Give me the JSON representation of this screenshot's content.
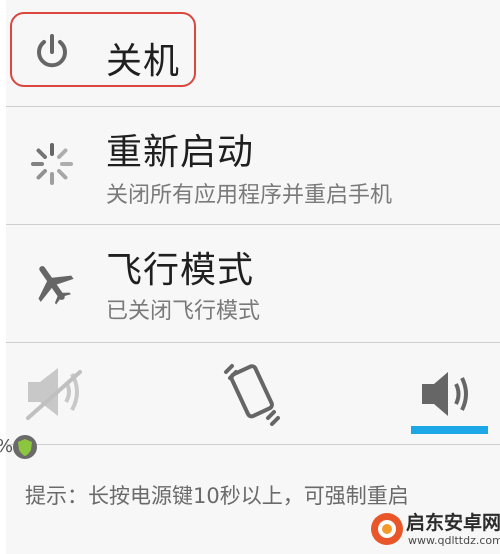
{
  "power_menu": {
    "power_off": {
      "label": "关机",
      "icon": "power-icon"
    },
    "restart": {
      "label": "重新启动",
      "subtitle": "关闭所有应用程序并重启手机",
      "icon": "loading-spinner-icon"
    },
    "airplane": {
      "label": "飞行模式",
      "subtitle": "已关闭飞行模式",
      "icon": "airplane-icon"
    }
  },
  "sound_modes": {
    "silent": {
      "icon": "muted-speaker-icon",
      "selected": false
    },
    "vibrate": {
      "icon": "vibrate-phone-icon",
      "selected": false
    },
    "sound_on": {
      "icon": "speaker-volume-icon",
      "selected": true
    }
  },
  "hint": "提示：长按电源键10秒以上，可强制重启",
  "status_fragment": {
    "percent_sign": "%"
  },
  "watermark": {
    "name": "启东安卓网",
    "url": "www.qdlttdz.com"
  },
  "colors": {
    "highlight": "#d9473f",
    "accent": "#1ca8e6",
    "divider": "#cfcfcf"
  }
}
